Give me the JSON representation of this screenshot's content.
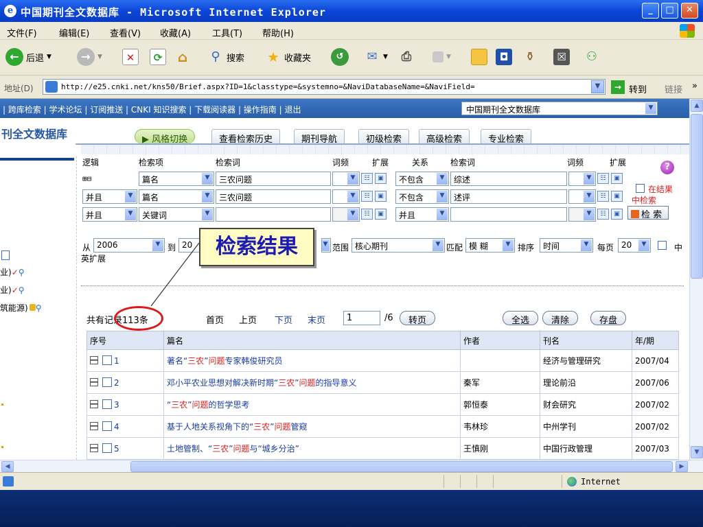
{
  "window": {
    "title": "中国期刊全文数据库 - Microsoft Internet Explorer",
    "buttons": [
      "_",
      "□",
      "✕"
    ]
  },
  "menubar": [
    "文件(F)",
    "编辑(E)",
    "查看(V)",
    "收藏(A)",
    "工具(T)",
    "帮助(H)"
  ],
  "toolbar": {
    "back": "后退",
    "search": "搜索",
    "favorites": "收藏夹"
  },
  "address": {
    "label": "地址(D)",
    "url": "http://e25.cnki.net/kns50/Brief.aspx?ID=1&classtype=&systemno=&NaviDatabaseName=&NaviField=",
    "go": "转到",
    "links": "链接"
  },
  "nav": {
    "links": "| 跨库检索 | 学术论坛 | 订阅推送 | CNKI 知识搜索 | 下载阅读器 | 操作指南 | 退出",
    "db_select": "中国期刊全文数据库"
  },
  "brand": "刊全文数据库",
  "tabs": [
    "风格切换",
    "查看检索历史",
    "期刊导航",
    "初级检索",
    "高级检索",
    "专业检索"
  ],
  "left_panel": {
    "rows": [
      "业)",
      "业)",
      "筑能源)"
    ]
  },
  "form": {
    "headers": {
      "logic": "逻辑",
      "field": "检索项",
      "term": "检索词",
      "freq": "词频",
      "expand": "扩展",
      "relation": "关系",
      "term2": "检索词",
      "freq2": "词频",
      "expand2": "扩展"
    },
    "expand_toggle": "⊞⊟",
    "rows": [
      {
        "logic": "",
        "field": "篇名",
        "term": "三农问题",
        "relation": "不包含",
        "term2": "综述"
      },
      {
        "logic": "并且",
        "field": "篇名",
        "term": "三农问题",
        "relation": "不包含",
        "term2": "述评"
      },
      {
        "logic": "并且",
        "field": "关键词",
        "term": "",
        "relation": "并且",
        "term2": ""
      }
    ],
    "in_results_1": "在结果",
    "in_results_2": "中检索",
    "search_button": "检 索",
    "from_label": "从",
    "from_year": "2006",
    "to_label": "到",
    "to_year": "20",
    "scope_label": "范围",
    "scope_value": "核心期刊",
    "match_label": "匹配",
    "match_value": "模 糊",
    "sort_label": "排序",
    "sort_value": "时间",
    "per_page_label": "每页",
    "per_page_value": "20",
    "cn_label": "中",
    "en_expand": "英扩展"
  },
  "callout": "检索结果",
  "results": {
    "total": "共有记录113条",
    "first": "首页",
    "prev": "上页",
    "next": "下页",
    "last": "末页",
    "page_input": "1",
    "page_of": "/6",
    "goto": "转页",
    "select_all": "全选",
    "clear": "清除",
    "save": "存盘",
    "columns": [
      "序号",
      "篇名",
      "作者",
      "刊名",
      "年/期"
    ],
    "rows": [
      {
        "no": "1",
        "title": [
          "著名“",
          "三农",
          "”",
          "问题",
          "专家韩俊研究员"
        ],
        "author": "",
        "journal": "经济与管理研究",
        "issue": "2007/04"
      },
      {
        "no": "2",
        "title": [
          "邓小平农业思想对解决新时期“",
          "三农",
          "”",
          "问题",
          "的指导意义"
        ],
        "author": "秦军",
        "journal": "理论前沿",
        "issue": "2007/06"
      },
      {
        "no": "3",
        "title": [
          "“",
          "三农",
          "”",
          "问题",
          "的哲学思考"
        ],
        "author": "郭恒泰",
        "journal": "财会研究",
        "issue": "2007/02"
      },
      {
        "no": "4",
        "title": [
          "基于人地关系视角下的“",
          "三农",
          "”",
          "问题",
          "管窥"
        ],
        "author": "韦林珍",
        "journal": "中州学刊",
        "issue": "2007/02"
      },
      {
        "no": "5",
        "title": [
          "土地管制、“",
          "三农",
          "”",
          "问题",
          "与“城乡分治”"
        ],
        "author": "王慎刚",
        "journal": "中国行政管理",
        "issue": "2007/03"
      }
    ]
  },
  "status": {
    "zone": "Internet"
  }
}
